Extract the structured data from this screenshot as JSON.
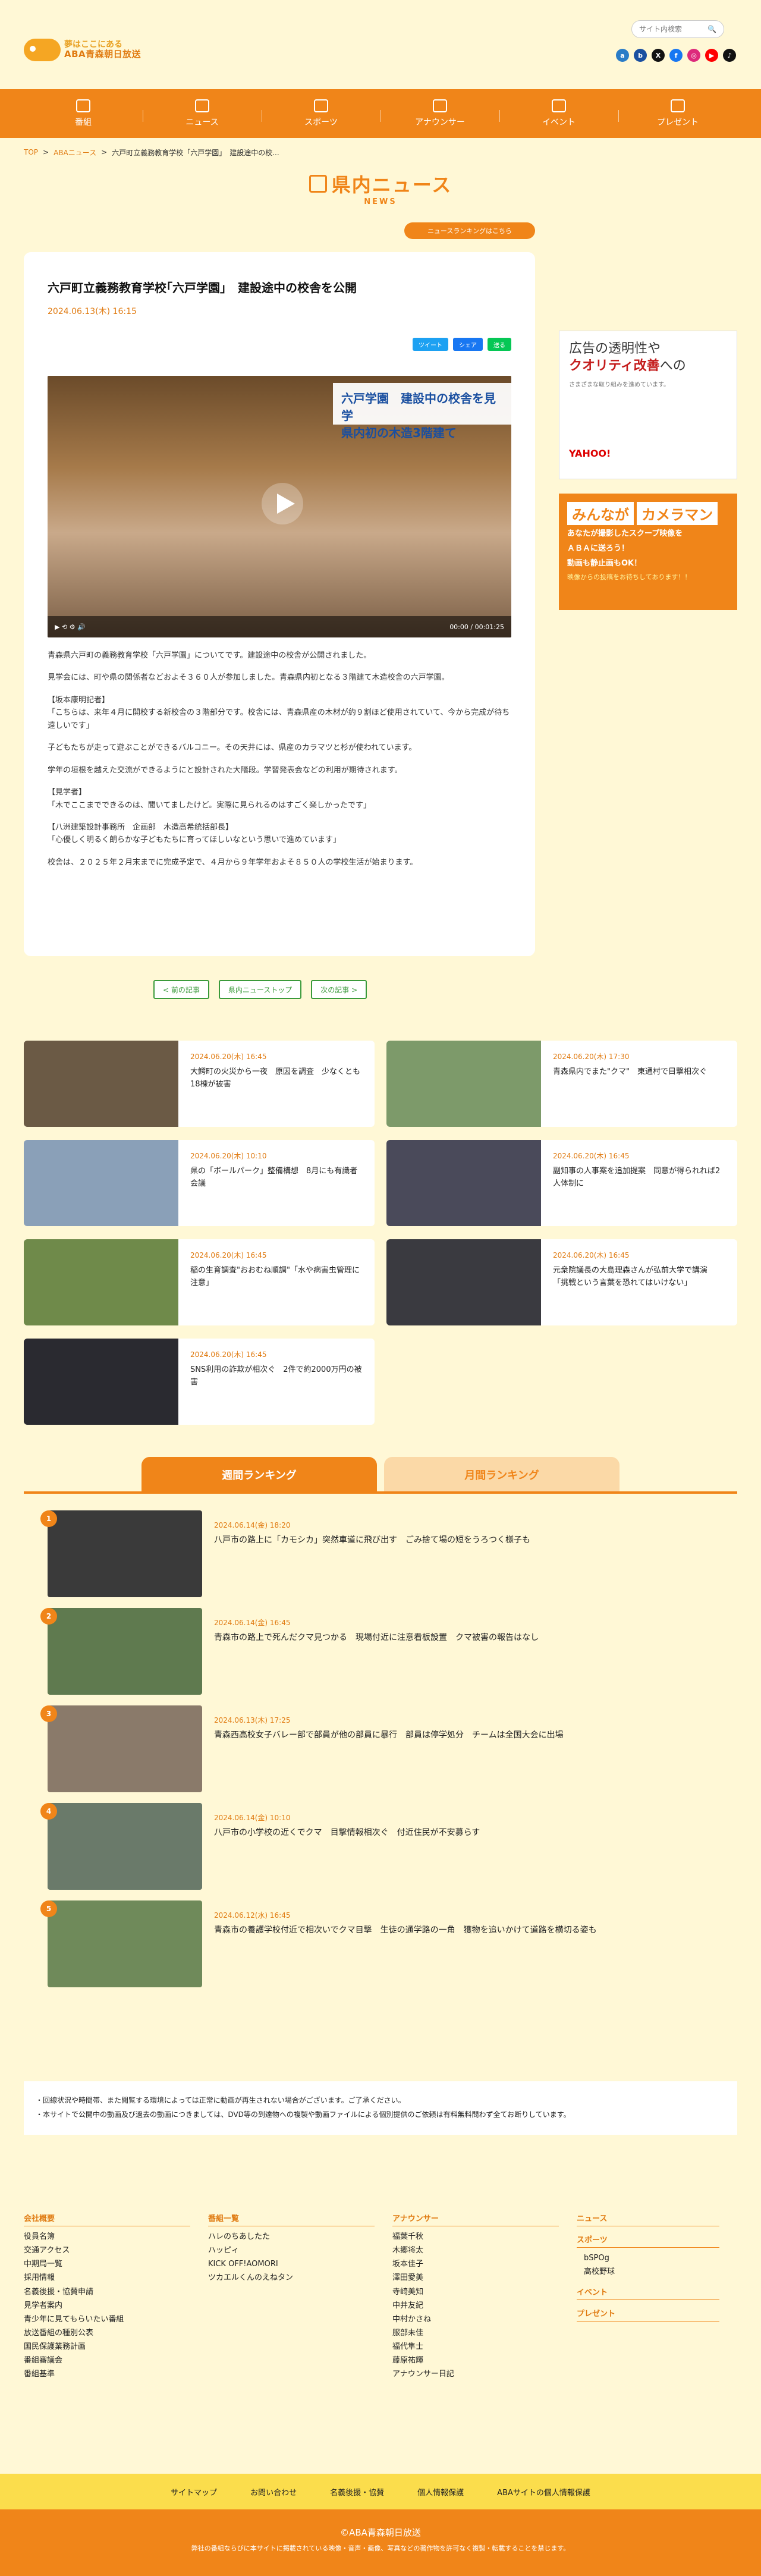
{
  "header": {
    "logo_line1": "夢はここにある",
    "logo_line2": "ABA青森朝日放送",
    "search_placeholder": "サイト内検索",
    "social": [
      {
        "name": "a-icon",
        "label": "a",
        "color": "#2a7cc7"
      },
      {
        "name": "b-icon",
        "label": "b",
        "color": "#1a4fa0"
      },
      {
        "name": "x-icon",
        "label": "X",
        "color": "#111111"
      },
      {
        "name": "facebook-icon",
        "label": "f",
        "color": "#1877f2"
      },
      {
        "name": "instagram-icon",
        "label": "◎",
        "color": "#dd2a7b"
      },
      {
        "name": "youtube-icon",
        "label": "▶",
        "color": "#ff0000"
      },
      {
        "name": "tiktok-icon",
        "label": "♪",
        "color": "#111111"
      }
    ]
  },
  "nav": [
    "番組",
    "ニュース",
    "スポーツ",
    "アナウンサー",
    "イベント",
    "プレゼント"
  ],
  "breadcrumb": [
    "TOP",
    "ABAニュース",
    "六戸町立義務教育学校「六戸学園」　建設途中の校..."
  ],
  "page_title": {
    "jp": "県内ニュース",
    "en": "NEWS"
  },
  "ranking_link": "ニュースランキングはこちら",
  "article": {
    "title": "六戸町立義務教育学校｢六戸学園｣　建設途中の校舎を公開",
    "date": "2024.06.13(木) 16:15",
    "share": [
      {
        "label": "ツイート",
        "color": "#1da1f2"
      },
      {
        "label": "シェア",
        "color": "#1877f2"
      },
      {
        "label": "送る",
        "color": "#06c755"
      }
    ],
    "video_caption": [
      "六戸学園　建設中の校舎を見学",
      "県内初の木造3階建て"
    ],
    "video_time": "00:00 / 00:01:25",
    "body": [
      "青森県六戸町の義務教育学校「六戸学園」についてです。建設途中の校舎が公開されました。",
      "見学会には、町や県の関係者などおよそ３６０人が参加しました。青森県内初となる３階建て木造校舎の六戸学園。",
      "【坂本康明記者】\n「こちらは、来年４月に開校する新校舎の３階部分です。校舎には、青森県産の木材が約９割ほど使用されていて、今から完成が待ち遠しいです」",
      "子どもたちが走って遊ぶことができるバルコニー。その天井には、県産のカラマツと杉が使われています。",
      "学年の垣根を越えた交流ができるようにと設計された大階段。学習発表会などの利用が期待されます。",
      "【見学者】\n「木でここまでできるのは、聞いてましたけど。実際に見られるのはすごく楽しかったです」",
      "【八洲建築設計事務所　企画部　木造高希統括部長】\n「心優しく明るく朗らかな子どもたちに育ってほしいなという思いで進めています」",
      "校舎は、２０２５年２月末までに完成予定で、４月から９年学年およそ８５０人の学校生活が始まります。"
    ]
  },
  "ads": {
    "ad1_line1": "広告の透明性や",
    "ad1_line2": "クオリティ改善",
    "ad1_suffix": "への",
    "ad1_sub": "さまざまな取り組みを進めています。",
    "ad1_brand": "YAHOO!",
    "ad2_title": "みんなが",
    "ad2_title2": "カメラマン",
    "ad2_l1": "あなたが撮影したスクープ映像を",
    "ad2_l2": "ＡＢＡに送ろう！",
    "ad2_l3": "動画も静止画もOK！",
    "ad2_l4": "映像からの投稿をお待ちしております！！"
  },
  "pager": [
    "< 前の記事",
    "県内ニューストップ",
    "次の記事 >"
  ],
  "related": [
    {
      "date": "2024.06.20(木) 16:45",
      "title": "大鰐町の火災から一夜　原因を調査　少なくとも18棟が被害",
      "color": "#6b5a45"
    },
    {
      "date": "2024.06.20(木) 17:30",
      "title": "青森県内でまた\"クマ\"　東通村で目撃相次ぐ",
      "color": "#7d9a6a"
    },
    {
      "date": "2024.06.20(木) 10:10",
      "title": "県の「ボールパーク」整備構想　8月にも有識者会議",
      "color": "#8aa0b8"
    },
    {
      "date": "2024.06.20(木) 16:45",
      "title": "副知事の人事案を追加提案　同意が得られれば2人体制に",
      "color": "#4a4a5a"
    },
    {
      "date": "2024.06.20(木) 16:45",
      "title": "稲の生育調査\"おおむね順調\"「水や病害虫管理に注意」",
      "color": "#6f8a4a"
    },
    {
      "date": "2024.06.20(木) 16:45",
      "title": "元衆院議長の大島理森さんが弘前大学で講演　「挑戦という言葉を恐れてはいけない」",
      "color": "#3a3a40"
    },
    {
      "date": "2024.06.20(木) 16:45",
      "title": "SNS利用の詐欺が相次ぐ　2件で約2000万円の被害",
      "color": "#2a2a30"
    }
  ],
  "ranking_tabs": [
    "週間ランキング",
    "月間ランキング"
  ],
  "ranking": [
    {
      "num": "1",
      "date": "2024.06.14(金) 18:20",
      "title": "八戸市の路上に「カモシカ」突然車道に飛び出す　ごみ捨て場の短をうろつく様子も",
      "color": "#3a3a3a"
    },
    {
      "num": "2",
      "date": "2024.06.14(金) 16:45",
      "title": "青森市の路上で死んだクマ見つかる　現場付近に注意看板設置　クマ被害の報告はなし",
      "color": "#5f7a4f"
    },
    {
      "num": "3",
      "date": "2024.06.13(木) 17:25",
      "title": "青森西高校女子バレー部で部員が他の部員に暴行　部員は停学処分　チームは全国大会に出場",
      "color": "#8a7a6a"
    },
    {
      "num": "4",
      "date": "2024.06.14(金) 10:10",
      "title": "八戸市の小学校の近くでクマ　目撃情報相次ぐ　付近住民が不安募らす",
      "color": "#6a7a6a"
    },
    {
      "num": "5",
      "date": "2024.06.12(水) 16:45",
      "title": "青森市の養護学校付近で相次いでクマ目撃　生徒の通学路の一角　獲物を追いかけて道路を横切る姿も",
      "color": "#6f8a5a"
    }
  ],
  "notice": [
    "・回線状況や時間帯、また閲覧する環境によっては正常に動画が再生されない場合がございます。ご了承ください。",
    "・本サイトで公開中の動画及び過去の動画につきましては、DVD等の到達物への複製や動画ファイルによる個別提供のご依頼は有料無料問わず全てお断りしています。"
  ],
  "footer": {
    "col1_title": "会社概要",
    "col1": [
      "役員名簿",
      "交通アクセス",
      "中期局一覧",
      "採用情報",
      "名義後援・協賛申請",
      "見学者案内",
      "青少年に見てもらいたい番組",
      "放送番組の種別公表",
      "国民保護業務計画",
      "番組審議会",
      "番組基準"
    ],
    "col2_title": "番組一覧",
    "col2": [
      "ハレのちあしたた",
      "ハッピィ",
      "KICK OFF!AOMORI",
      "ツカエルくんのえねタン"
    ],
    "col3_title": "アナウンサー",
    "col3": [
      "福葉千秋",
      "木郷将太",
      "坂本佳子",
      "澤田愛美",
      "寺崎美知",
      "中井友紀",
      "中村かさね",
      "服部未佳",
      "福代隼士",
      "藤原祐輝",
      "アナウンサー日記"
    ],
    "col4_title": "ニュース",
    "col4_sports": "スポーツ",
    "col4_sports_items": [
      "bSPOg",
      "高校野球"
    ],
    "col4_event": "イベント",
    "col4_present": "プレゼント"
  },
  "footer_nav": [
    "サイトマップ",
    "お問い合わせ",
    "名義後援・協賛",
    "個人情報保護",
    "ABAサイトの個人情報保護"
  ],
  "copyright": "©ABA青森朝日放送",
  "copyright_note": "弊社の番組ならびに本サイトに掲載されている映像・音声・画像、写真などの著作物を許可なく複製・転載することを禁じます。"
}
